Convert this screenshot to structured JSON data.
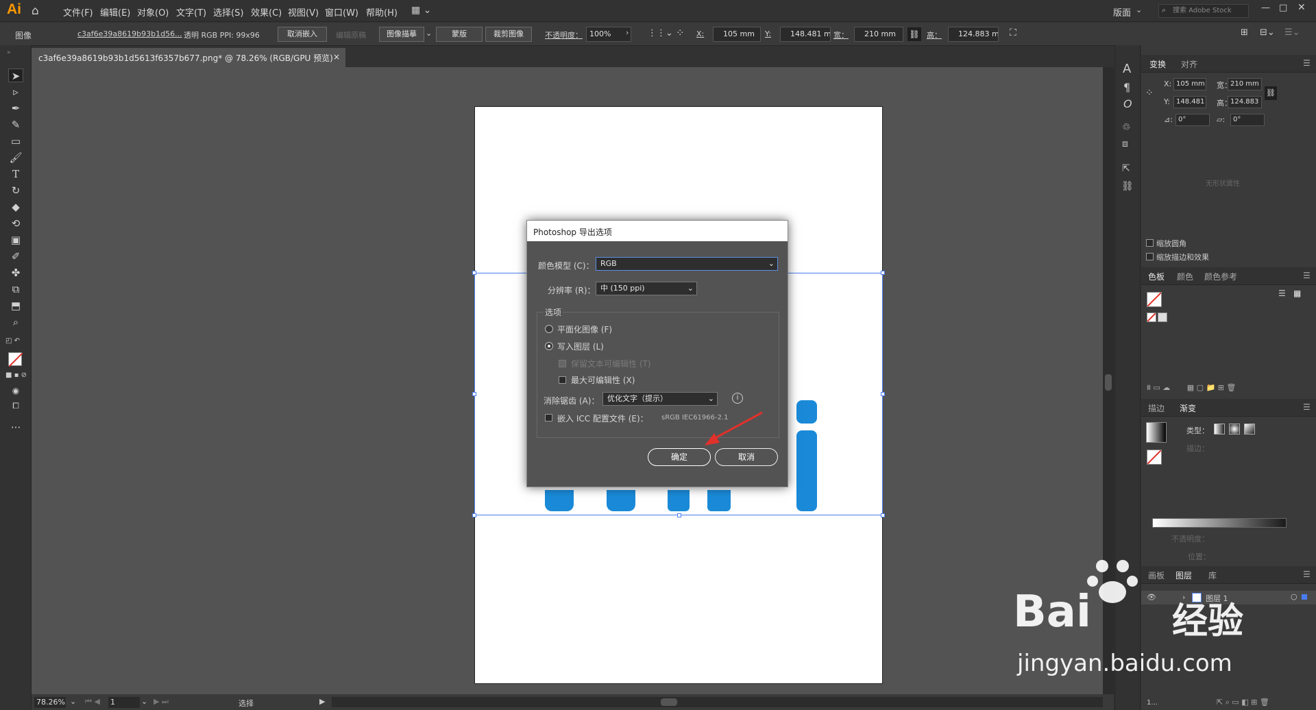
{
  "app": {
    "logo": "Ai"
  },
  "menu": {
    "items": [
      "文件(F)",
      "编辑(E)",
      "对象(O)",
      "文字(T)",
      "选择(S)",
      "效果(C)",
      "视图(V)",
      "窗口(W)",
      "帮助(H)"
    ],
    "workspace": "版面",
    "search_placeholder": "搜索 Adobe Stock"
  },
  "control_bar": {
    "object_type": "图像",
    "filename": "c3af6e39a8619b93b1d56...",
    "image_info": "透明 RGB  PPI: 99x96",
    "unembed": "取消嵌入",
    "edit_original": "编辑原稿",
    "image_trace": "图像描摹",
    "mask": "蒙版",
    "crop": "裁剪图像",
    "opacity_label": "不透明度：",
    "opacity_value": "100%",
    "x_label": "X:",
    "x_value": "105 mm",
    "y_label": "Y:",
    "y_value": "148.481 m",
    "w_label": "宽：",
    "w_value": "210 mm",
    "h_label": "高：",
    "h_value": "124.883 m"
  },
  "document": {
    "tab_title": "c3af6e39a8619b93b1d5613f6357b677.png* @ 78.26% (RGB/GPU 预览)",
    "close": "×"
  },
  "status": {
    "zoom": "78.26%",
    "page": "1",
    "tool": "选择"
  },
  "transform_panel": {
    "tabs": [
      "变换",
      "对齐"
    ],
    "x_label": "X:",
    "x_value": "105 mm",
    "w_label": "宽：",
    "w_value": "210 mm",
    "y_label": "Y:",
    "y_value": "148.481 r",
    "h_label": "高：",
    "h_value": "124.883 r",
    "angle_value": "0°",
    "shear_value": "0°",
    "no_shape": "无形状属性",
    "scale_corners": "缩放圆角",
    "scale_strokes": "缩放描边和效果"
  },
  "swatch_panel": {
    "tabs": [
      "色板",
      "颜色",
      "颜色参考"
    ]
  },
  "gradient_panel": {
    "tabs": [
      "描边",
      "渐变"
    ],
    "type_label": "类型：",
    "stroke_label": "描边：",
    "opacity_label": "不透明度：",
    "position_label": "位置："
  },
  "layers_panel": {
    "tabs": [
      "画板",
      "图层",
      "库"
    ],
    "layer_name": "图层 1",
    "footer": "1..."
  },
  "dialog": {
    "title": "Photoshop 导出选项",
    "color_model_label": "颜色模型 (C)：",
    "color_model_value": "RGB",
    "resolution_label": "分辨率 (R)：",
    "resolution_value": "中 (150 ppi)",
    "options_label": "选项",
    "flatten": "平面化图像 (F)",
    "write_layers": "写入图层 (L)",
    "preserve_text": "保留文本可编辑性 (T)",
    "max_edit": "最大可编辑性 (X)",
    "antialias_label": "消除锯齿 (A)：",
    "antialias_value": "优化文字（提示）",
    "embed_icc": "嵌入 ICC 配置文件 (E)：",
    "icc_profile": "sRGB IEC61966-2.1",
    "ok": "确定",
    "cancel": "取消"
  },
  "watermark": {
    "brand": "Bai",
    "brand_cn": "经验",
    "url": "jingyan.baidu.com"
  },
  "colors": {
    "accent": "#1a8ad8",
    "logo": "#ff9a00",
    "selection": "#4a7cf0",
    "arrow": "#e0312b"
  }
}
